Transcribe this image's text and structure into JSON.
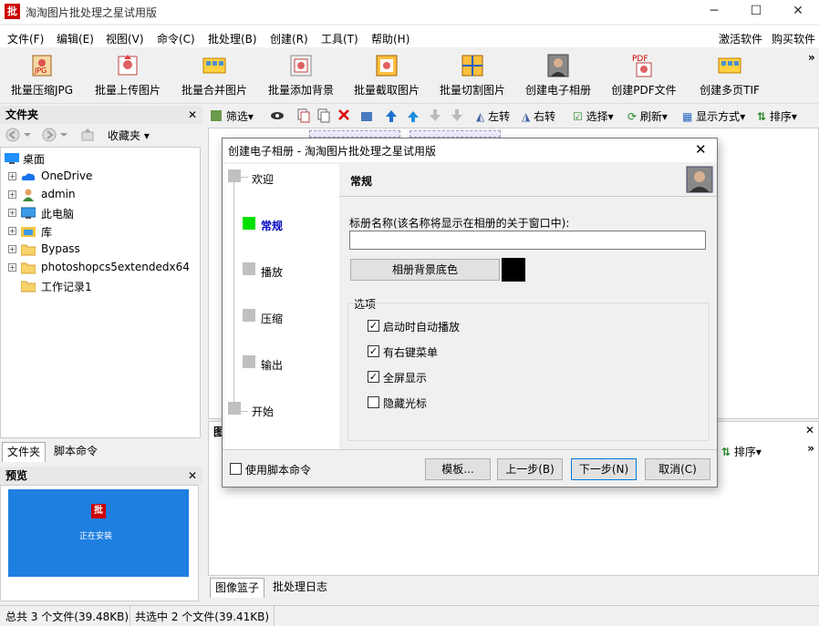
{
  "window": {
    "title": "淘淘图片批处理之星试用版",
    "logo_text": "批",
    "minimize": "─",
    "maximize": "☐",
    "close": "✕"
  },
  "menu": {
    "items": [
      "文件(F)",
      "编辑(E)",
      "视图(V)",
      "命令(C)",
      "批处理(B)",
      "创建(R)",
      "工具(T)",
      "帮助(H)"
    ],
    "right": [
      "激活软件",
      "购买软件"
    ]
  },
  "toolbar": {
    "tools": [
      {
        "label": "批量压缩JPG",
        "icon": "compress-jpg-icon"
      },
      {
        "label": "批量上传图片",
        "icon": "upload-image-icon"
      },
      {
        "label": "批量合并图片",
        "icon": "merge-image-icon"
      },
      {
        "label": "批量添加背景",
        "icon": "add-background-icon"
      },
      {
        "label": "批量截取图片",
        "icon": "crop-image-icon"
      },
      {
        "label": "批量切割图片",
        "icon": "cut-image-icon"
      },
      {
        "label": "创建电子相册",
        "icon": "album-icon"
      },
      {
        "label": "创建PDF文件",
        "icon": "pdf-icon"
      },
      {
        "label": "创建多页TIF",
        "icon": "tif-icon"
      }
    ],
    "more": "»"
  },
  "folder_pane": {
    "title": "文件夹",
    "close": "✕",
    "favorites": "收藏夹",
    "tree": [
      {
        "label": "桌面",
        "expandable": false,
        "icon": "desktop-icon"
      },
      {
        "label": "OneDrive",
        "expandable": true,
        "icon": "cloud-icon"
      },
      {
        "label": "admin",
        "expandable": true,
        "icon": "user-icon"
      },
      {
        "label": "此电脑",
        "expandable": true,
        "icon": "computer-icon"
      },
      {
        "label": "库",
        "expandable": true,
        "icon": "library-icon"
      },
      {
        "label": "Bypass",
        "expandable": true,
        "icon": "folder-icon"
      },
      {
        "label": "photoshopcs5extendedx64",
        "expandable": true,
        "icon": "folder-icon"
      },
      {
        "label": "工作记录1",
        "expandable": false,
        "icon": "folder-icon"
      }
    ],
    "tabs": [
      "文件夹",
      "脚本命令"
    ]
  },
  "preview_pane": {
    "title": "预览",
    "close": "✕",
    "screen_logo": "批",
    "screen_text": "正在安装"
  },
  "right_toolbar": {
    "filter": "筛选",
    "rotate_left": "左转",
    "rotate_right": "右转",
    "select": "选择",
    "refresh": "刷新",
    "view_mode": "显示方式",
    "sort": "排序"
  },
  "basket": {
    "title": "图",
    "close": "✕",
    "sort": "排序",
    "more": "»",
    "tabs": [
      "图像篮子",
      "批处理日志"
    ]
  },
  "status": {
    "total": "总共 3 个文件(39.48KB)",
    "selected": "共选中 2 个文件(39.41KB)"
  },
  "dialog": {
    "title": "创建电子相册 - 淘淘图片批处理之星试用版",
    "close": "✕",
    "steps": [
      "欢迎",
      "常规",
      "播放",
      "压缩",
      "输出",
      "开始"
    ],
    "active_step": "常规",
    "active_color": "#00e000",
    "active_text_color": "#0000c0",
    "section_title": "常规",
    "album_name_label": "标册名称(该名称将显示在相册的关于窗口中):",
    "album_name_value": "",
    "bg_color_button": "相册背景底色",
    "bg_color": "#000000",
    "options_label": "选项",
    "options": [
      {
        "label": "启动时自动播放",
        "checked": true
      },
      {
        "label": "有右键菜单",
        "checked": true
      },
      {
        "label": "全屏显示",
        "checked": true
      },
      {
        "label": "隐藏光标",
        "checked": false
      }
    ],
    "use_script": "使用脚本命令",
    "use_script_checked": false,
    "buttons": {
      "template": "模板...",
      "prev": "上一步(B)",
      "next": "下一步(N)",
      "cancel": "取消(C)"
    }
  }
}
